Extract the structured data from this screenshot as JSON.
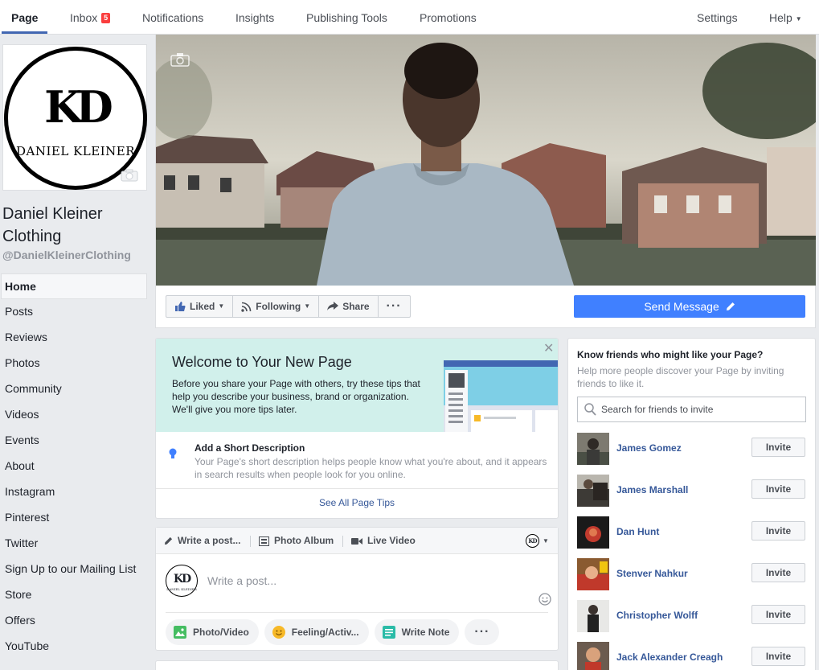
{
  "topnav": {
    "tabs": [
      {
        "label": "Page"
      },
      {
        "label": "Inbox",
        "badge": "5"
      },
      {
        "label": "Notifications"
      },
      {
        "label": "Insights"
      },
      {
        "label": "Publishing Tools"
      },
      {
        "label": "Promotions"
      }
    ],
    "settings": "Settings",
    "help": "Help"
  },
  "profile": {
    "logo_mark": "KD",
    "logo_text": "DANIEL KLEINER",
    "name": "Daniel Kleiner Clothing",
    "handle": "@DanielKleinerClothing"
  },
  "leftnav": {
    "items": [
      "Home",
      "Posts",
      "Reviews",
      "Photos",
      "Community",
      "Videos",
      "Events",
      "About",
      "Instagram",
      "Pinterest",
      "Twitter",
      "Sign Up to our Mailing List",
      "Store",
      "Offers",
      "YouTube"
    ]
  },
  "actions": {
    "liked": "Liked",
    "following": "Following",
    "share": "Share",
    "send_message": "Send Message"
  },
  "welcome": {
    "title": "Welcome to Your New Page",
    "description": "Before you share your Page with others, try these tips that help you describe your business, brand or organization. We'll give you more tips later.",
    "tip_title": "Add a Short Description",
    "tip_description": "Your Page's short description helps people know what you're about, and it appears in search results when people look for you online.",
    "see_all": "See All Page Tips"
  },
  "composer": {
    "tabs": [
      "Write a post...",
      "Photo Album",
      "Live Video"
    ],
    "placeholder": "Write a post...",
    "buttons": [
      "Photo/Video",
      "Feeling/Activ...",
      "Write Note"
    ]
  },
  "invite": {
    "title": "Know friends who might like your Page?",
    "description": "Help more people discover your Page by inviting friends to like it.",
    "search_placeholder": "Search for friends to invite",
    "button_label": "Invite",
    "friends": [
      {
        "name": "James Gomez"
      },
      {
        "name": "James Marshall"
      },
      {
        "name": "Dan Hunt"
      },
      {
        "name": "Stenver Nahkur"
      },
      {
        "name": "Christopher Wolff"
      },
      {
        "name": "Jack Alexander Creagh"
      }
    ]
  },
  "colors": {
    "brand_blue": "#4267b2",
    "send_blue": "#4080ff",
    "link_blue": "#365899",
    "welcome_bg": "#d1f0eb",
    "badge_red": "#fa3e3e"
  }
}
